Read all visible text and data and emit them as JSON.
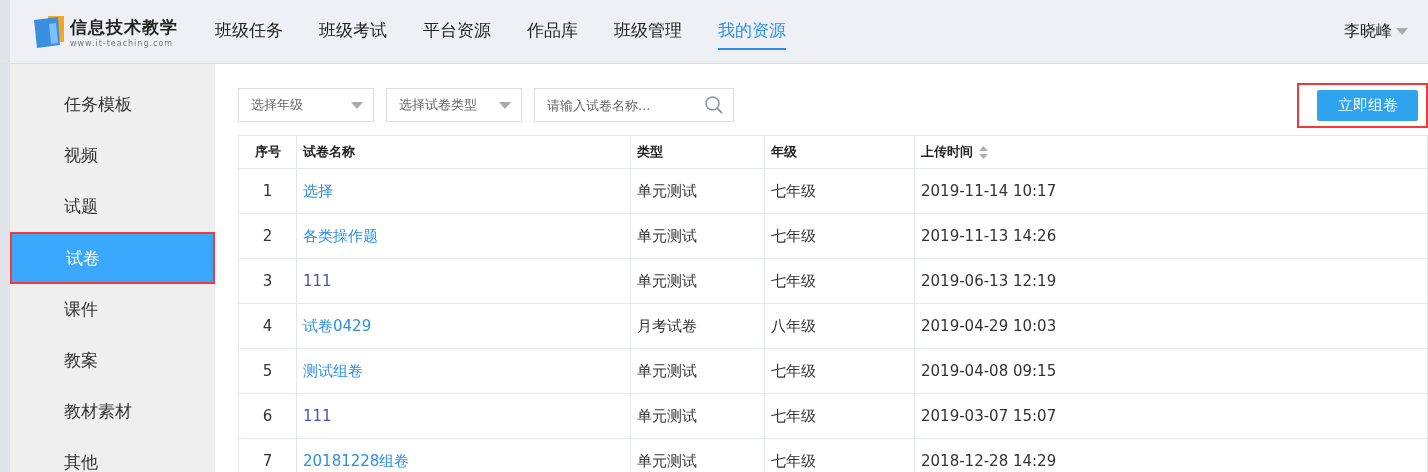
{
  "header": {
    "logo_title": "信息技术教学",
    "logo_url": "www.it-teaching.com",
    "nav": [
      {
        "label": "班级任务",
        "selected": false
      },
      {
        "label": "班级考试",
        "selected": false
      },
      {
        "label": "平台资源",
        "selected": false
      },
      {
        "label": "作品库",
        "selected": false
      },
      {
        "label": "班级管理",
        "selected": false
      },
      {
        "label": "我的资源",
        "selected": true
      }
    ],
    "user": "李晓峰"
  },
  "sidebar": {
    "items": [
      {
        "label": "任务模板",
        "selected": false
      },
      {
        "label": "视频",
        "selected": false
      },
      {
        "label": "试题",
        "selected": false
      },
      {
        "label": "试卷",
        "selected": true
      },
      {
        "label": "课件",
        "selected": false
      },
      {
        "label": "教案",
        "selected": false
      },
      {
        "label": "教材素材",
        "selected": false
      },
      {
        "label": "其他",
        "selected": false
      }
    ]
  },
  "filters": {
    "grade": "选择年级",
    "paper_type": "选择试卷类型",
    "search": {
      "placeholder": "请输入试卷名称..."
    }
  },
  "create_button": "立即组卷",
  "table": {
    "columns": [
      "序号",
      "试卷名称",
      "类型",
      "年级",
      "上传时间"
    ],
    "rows": [
      {
        "no": "1",
        "name": "选择",
        "visited": false,
        "type": "单元测试",
        "grade": "七年级",
        "time": "2019-11-14 10:17"
      },
      {
        "no": "2",
        "name": "各类操作题",
        "visited": false,
        "type": "单元测试",
        "grade": "七年级",
        "time": "2019-11-13 14:26"
      },
      {
        "no": "3",
        "name": "111",
        "visited": true,
        "type": "单元测试",
        "grade": "七年级",
        "time": "2019-06-13 12:19"
      },
      {
        "no": "4",
        "name": "试卷0429",
        "visited": false,
        "type": "月考试卷",
        "grade": "八年级",
        "time": "2019-04-29 10:03"
      },
      {
        "no": "5",
        "name": "测试组卷",
        "visited": false,
        "type": "单元测试",
        "grade": "七年级",
        "time": "2019-04-08 09:15"
      },
      {
        "no": "6",
        "name": "111",
        "visited": true,
        "type": "单元测试",
        "grade": "七年级",
        "time": "2019-03-07 15:07"
      },
      {
        "no": "7",
        "name": "20181228组卷",
        "visited": false,
        "type": "单元测试",
        "grade": "七年级",
        "time": "2018-12-28 14:29"
      }
    ]
  }
}
